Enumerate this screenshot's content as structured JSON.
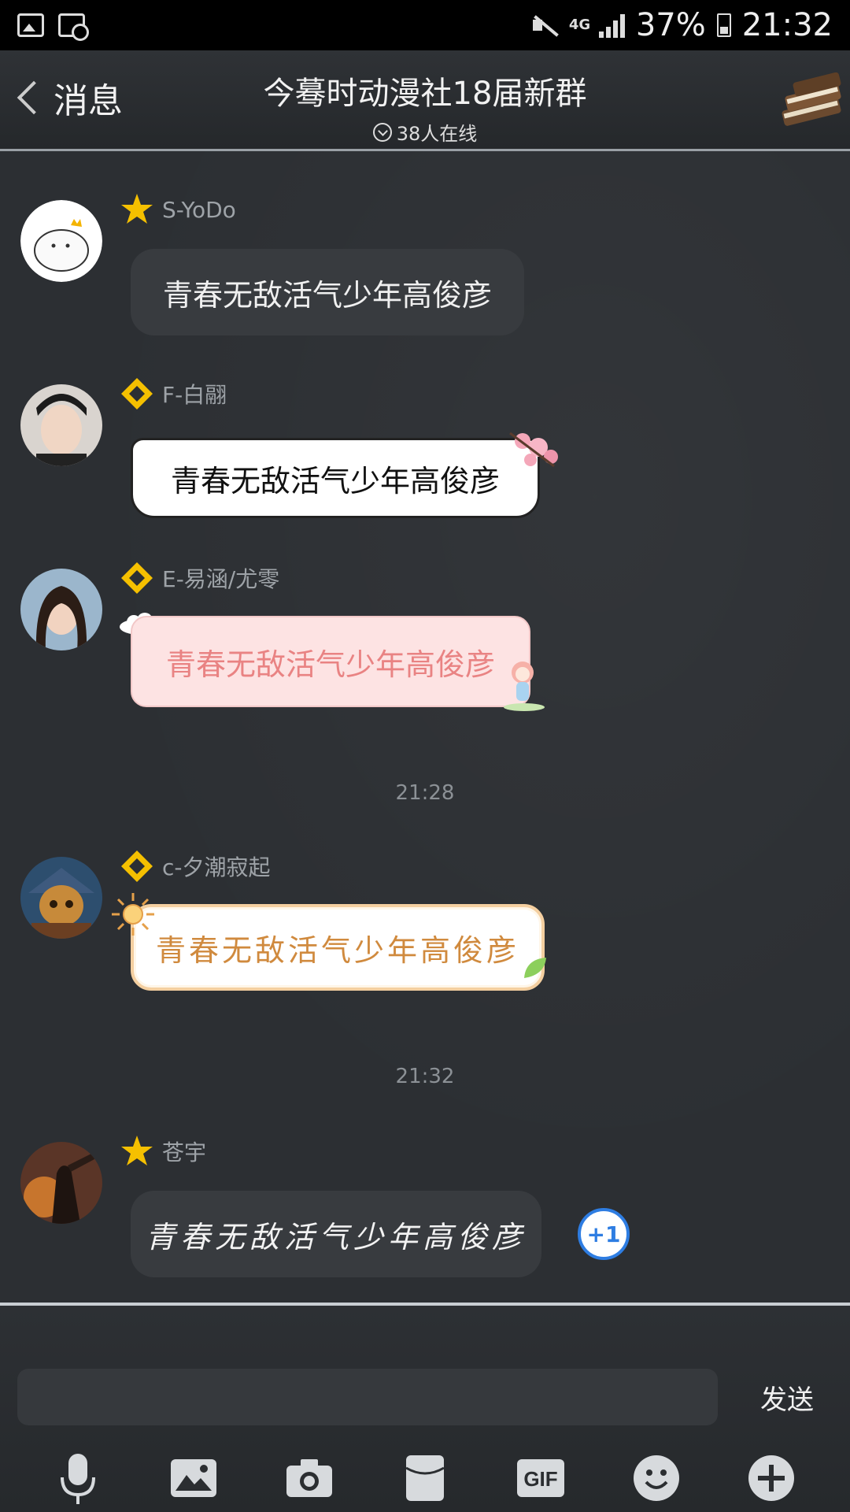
{
  "status_bar": {
    "network": "4G",
    "battery": "37%",
    "time": "21:32"
  },
  "header": {
    "back_label": "消息",
    "title": "今蓦时动漫社18届新群",
    "online": "38人在线"
  },
  "messages": [
    {
      "sender": "S-YoDo",
      "text": "青春无敌活气少年高俊彦",
      "badge": "star"
    },
    {
      "sender": "F-白翮",
      "text": "青春无敌活气少年高俊彦",
      "badge": "diamond"
    },
    {
      "sender": "E-易涵/尤零",
      "text": "青春无敌活气少年高俊彦",
      "badge": "diamond"
    },
    {
      "sender": "c-夕潮寂起",
      "text": "青春无敌活气少年高俊彦",
      "badge": "diamond"
    },
    {
      "sender": "苍宇",
      "text": "青春无敌活气少年高俊彦",
      "badge": "star"
    }
  ],
  "timestamps": [
    "21:28",
    "21:32"
  ],
  "plus_one": "+1",
  "input": {
    "placeholder": "",
    "send_label": "发送"
  },
  "toolbar": {
    "gif_label": "GIF"
  },
  "colors": {
    "accent_blue": "#2e7de2",
    "badge_yellow": "#f5c000",
    "pink_text": "#e98383",
    "orange_text": "#d08a3e"
  }
}
